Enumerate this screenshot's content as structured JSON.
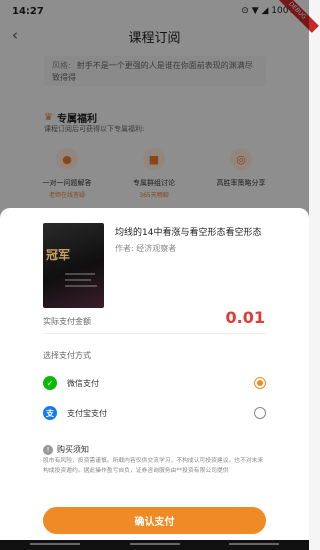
{
  "status_bar": {
    "time": "14:27",
    "right": "⊙ ▼ ◢ 100%"
  },
  "debug_ribbon": "DEBUG",
  "header": {
    "title": "课程订阅",
    "back_icon": "chevron-left-icon"
  },
  "quote": {
    "label": "风格:",
    "text": "射手不是一个更强的人是谁在你面前表现的渊满尽致得得"
  },
  "benefits": {
    "title": "专属福利",
    "subtitle": "课程订阅后可获得以下专属福利:",
    "items": [
      {
        "name": "一对一问题解答",
        "sub": "老师在线答疑",
        "icon": "lightbulb-icon"
      },
      {
        "name": "专属群组讨论",
        "sub": "365天畅聊",
        "icon": "chat-icon"
      },
      {
        "name": "高胜率策略分享",
        "sub": "",
        "icon": "target-icon"
      }
    ]
  },
  "sheet": {
    "thumbnail_text": "冠军",
    "course_title": "均线的14中看涨与看空形态看空形态",
    "author": "作者: 经济观察者",
    "pay_label": "实际支付金额",
    "amount": "0.01",
    "method_title": "选择支付方式",
    "methods": [
      {
        "name": "微信支付",
        "icon": "wechat-pay-icon",
        "selected": true,
        "color": "#09bb07"
      },
      {
        "name": "支付宝支付",
        "icon": "alipay-icon",
        "selected": false,
        "color": "#1677ff"
      }
    ],
    "notice_title": "购买须知",
    "notice_body": "股市有风险，投资需谨慎。所载内容仅供交流学习，不构成认可投资建议，也不对未来构成投资邀约。据此操作盈亏自负，证券咨询服务由**投资有限公司提供",
    "confirm_label": "确认支付"
  },
  "colors": {
    "accent": "#f08a24",
    "amount": "#e53935"
  }
}
